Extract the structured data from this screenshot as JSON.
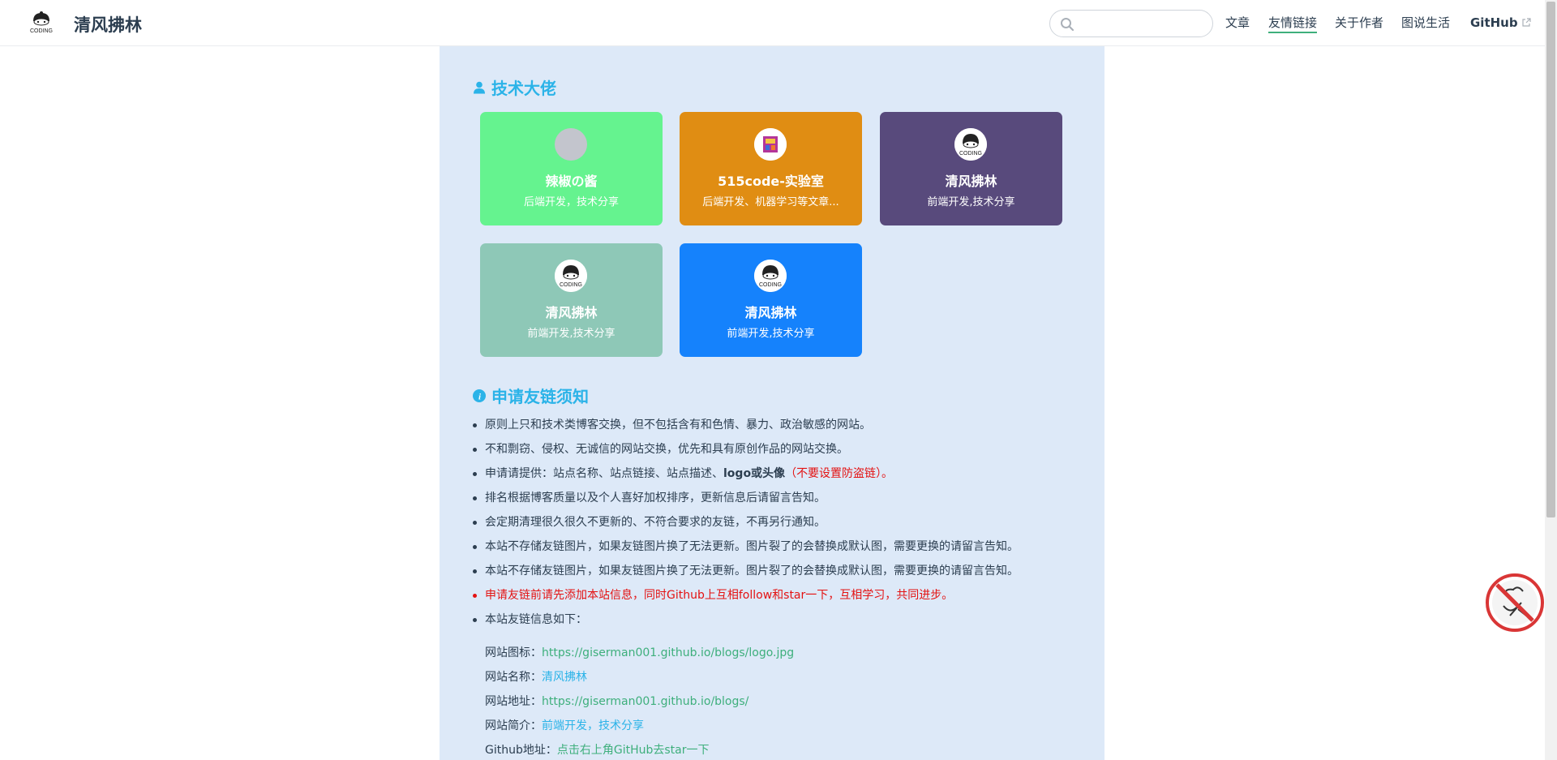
{
  "header": {
    "logo_text": "CODING",
    "site_name": "清风拂林",
    "search": {
      "placeholder": "",
      "value": ""
    },
    "nav": [
      {
        "label": "文章",
        "active": false
      },
      {
        "label": "友情链接",
        "active": true
      },
      {
        "label": "关于作者",
        "active": false
      },
      {
        "label": "图说生活",
        "active": false
      },
      {
        "label": "GitHub",
        "active": false,
        "external": true
      }
    ]
  },
  "section_friends": {
    "title": "技术大佬",
    "icon": "user-icon",
    "cards": [
      {
        "name": "辣椒の酱",
        "desc": "后端开发，技术分享",
        "color": "#65f38f",
        "avatar": "blank"
      },
      {
        "name": "515code-实验室",
        "desc": "后端开发、机器学习等文章...",
        "color": "#e08d13",
        "avatar": "lab-logo"
      },
      {
        "name": "清风拂林",
        "desc": "前端开发,技术分享",
        "color": "#584a7c",
        "avatar": "coding-logo"
      },
      {
        "name": "清风拂林",
        "desc": "前端开发,技术分享",
        "color": "#8ec8b7",
        "avatar": "coding-logo"
      },
      {
        "name": "清风拂林",
        "desc": "前端开发,技术分享",
        "color": "#1582fc",
        "avatar": "coding-logo"
      }
    ]
  },
  "section_rules": {
    "title": "申请友链须知",
    "icon": "info-icon",
    "items": {
      "r1": "原则上只和技术类博客交换，但不包括含有和色情、暴力、政治敏感的网站。",
      "r2": "不和剽窃、侵权、无诚信的网站交换，优先和具有原创作品的网站交换。",
      "r3_a": "申请请提供：站点名称、站点链接、站点描述、",
      "r3_b": "logo或头像",
      "r3_c": "（",
      "r3_d": "不要设置防盗链",
      "r3_e": "）。",
      "r4": "排名根据博客质量以及个人喜好加权排序，更新信息后请留言告知。",
      "r5": "会定期清理很久很久不更新的、不符合要求的友链，不再另行通知。",
      "r6": "本站不存储友链图片，如果友链图片换了无法更新。图片裂了的会替换成默认图，需要更换的请留言告知。",
      "r7": "本站不存储友链图片，如果友链图片换了无法更新。图片裂了的会替换成默认图，需要更换的请留言告知。",
      "r8": "申请友链前请先添加本站信息，同时Github上互相follow和star一下，互相学习，共同进步。",
      "r9": "本站友链信息如下："
    }
  },
  "site_info": {
    "icon_label": "网站图标：",
    "icon_value": "https://giserman001.github.io/blogs/logo.jpg",
    "name_label": "网站名称：",
    "name_value": "清风拂林",
    "url_label": "网站地址：",
    "url_value": "https://giserman001.github.io/blogs/",
    "desc_label": "网站简介：",
    "desc_value": "前端开发，技术分享",
    "github_label": "Github地址：",
    "github_value": "点击右上角GitHub去star一下"
  },
  "colors": {
    "accent_green": "#3eaf7c",
    "title_blue": "#2bb3e8",
    "warning_red": "#e41212",
    "page_bg": "#dde9f8"
  }
}
